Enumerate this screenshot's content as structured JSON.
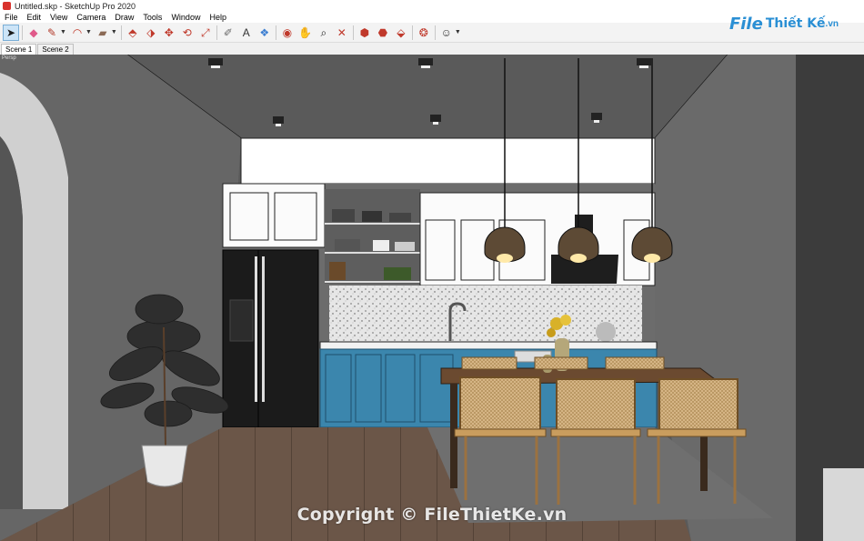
{
  "window": {
    "title": "Untitled.skp - SketchUp Pro 2020"
  },
  "menu": [
    "File",
    "Edit",
    "View",
    "Camera",
    "Draw",
    "Tools",
    "Window",
    "Help"
  ],
  "toolbar": {
    "tools": [
      {
        "name": "select-tool-icon",
        "glyph": "➤",
        "color": "#1a1a1a",
        "selected": true
      },
      {
        "name": "eraser-tool-icon",
        "glyph": "◆",
        "color": "#e05a8a"
      },
      {
        "name": "pencil-line-tool-icon",
        "glyph": "✎",
        "color": "#b23a2a",
        "dropdown": true
      },
      {
        "name": "arc-tool-icon",
        "glyph": "◠",
        "color": "#c0392b",
        "dropdown": true
      },
      {
        "name": "rectangle-tool-icon",
        "glyph": "▰",
        "color": "#8b6a55",
        "dropdown": true
      },
      {
        "name": "push-pull-tool-icon",
        "glyph": "⬘",
        "color": "#c0392b"
      },
      {
        "name": "follow-me-tool-icon",
        "glyph": "⬗",
        "color": "#c0392b"
      },
      {
        "name": "move-tool-icon",
        "glyph": "✥",
        "color": "#c0392b"
      },
      {
        "name": "rotate-tool-icon",
        "glyph": "⟲",
        "color": "#c0392b"
      },
      {
        "name": "scale-tool-icon",
        "glyph": "⤢",
        "color": "#c0392b"
      },
      {
        "name": "tape-measure-tool-icon",
        "glyph": "✐",
        "color": "#6a6a6a"
      },
      {
        "name": "text-tool-icon",
        "glyph": "A",
        "color": "#333333"
      },
      {
        "name": "paint-bucket-tool-icon",
        "glyph": "❖",
        "color": "#3d7fd1"
      },
      {
        "name": "orbit-tool-icon",
        "glyph": "◉",
        "color": "#c0392b"
      },
      {
        "name": "pan-tool-icon",
        "glyph": "✋",
        "color": "#d4a017"
      },
      {
        "name": "zoom-tool-icon",
        "glyph": "⌕",
        "color": "#1a1a1a"
      },
      {
        "name": "zoom-extents-tool-icon",
        "glyph": "✕",
        "color": "#c0392b"
      },
      {
        "name": "warehouse-tool-icon",
        "glyph": "⬢",
        "color": "#c0392b"
      },
      {
        "name": "extension-warehouse-tool-icon",
        "glyph": "⬣",
        "color": "#c0392b"
      },
      {
        "name": "send-to-layout-tool-icon",
        "glyph": "⬙",
        "color": "#c0392b"
      },
      {
        "name": "extension-manager-tool-icon",
        "glyph": "❂",
        "color": "#c0392b"
      },
      {
        "name": "account-user-icon",
        "glyph": "☺",
        "color": "#333333",
        "dropdown": true
      }
    ]
  },
  "brand": {
    "file": "File",
    "rest": "Thiết Kế",
    "ext": ".vn"
  },
  "tabs": [
    {
      "label": "Scene 1",
      "active": true
    },
    {
      "label": "Scene 2",
      "active": false
    }
  ],
  "viewport": {
    "label": "Persp"
  },
  "watermark": "Copyright © FileThietKe.vn"
}
